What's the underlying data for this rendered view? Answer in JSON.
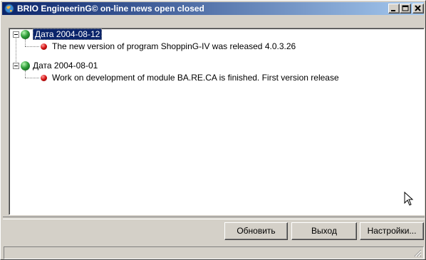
{
  "window": {
    "title": "BRIO EngineerinG© on-line news open closed"
  },
  "news": [
    {
      "date_label": "Дата 2004-08-12",
      "selected": true,
      "items": [
        "The new version of program ShoppinG-IV was released 4.0.3.26"
      ]
    },
    {
      "date_label": "Дата 2004-08-01",
      "selected": false,
      "items": [
        "Work on development of module BA.RE.CA is finished. First version release"
      ]
    }
  ],
  "buttons": {
    "refresh": "Обновить",
    "exit": "Выход",
    "settings": "Настройки..."
  },
  "icons": {
    "app": "globe-app-icon",
    "minimize": "minimize-icon",
    "maximize": "maximize-icon",
    "close": "close-icon",
    "date_node": "green-globe-icon",
    "news_item": "red-bullet-icon"
  }
}
